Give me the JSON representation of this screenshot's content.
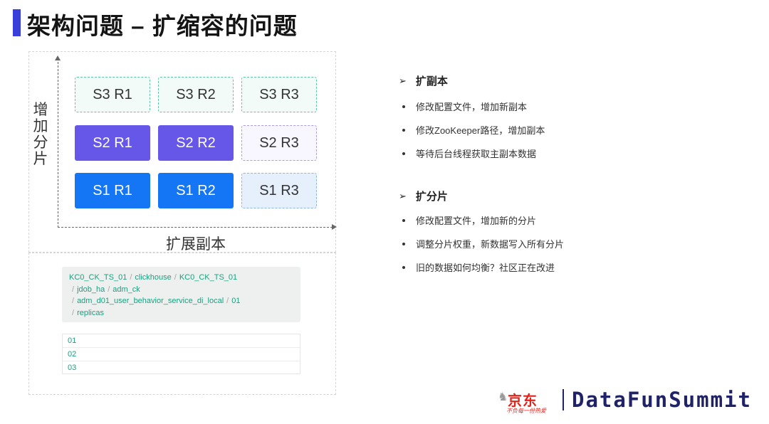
{
  "title": "架构问题 – 扩缩容的问题",
  "diagram": {
    "y_axis_label": "增加分片",
    "x_axis_label": "扩展副本",
    "rows": [
      [
        "S3 R1",
        "S3 R2",
        "S3 R3"
      ],
      [
        "S2 R1",
        "S2 R2",
        "S2 R3"
      ],
      [
        "S1 R1",
        "S1 R2",
        "S1 R3"
      ]
    ]
  },
  "zk_path": {
    "segments": [
      "KC0_CK_TS_01",
      "clickhouse",
      "KC0_CK_TS_01",
      "jdob_ha",
      "adm_ck",
      "adm_d01_user_behavior_service_di_local",
      "01",
      "replicas"
    ],
    "separator": "/"
  },
  "replica_list": [
    "01",
    "02",
    "03"
  ],
  "sections": [
    {
      "heading": "扩副本",
      "bullets": [
        "修改配置文件，增加新副本",
        "修改ZooKeeper路径，增加副本",
        "等待后台线程获取主副本数据"
      ]
    },
    {
      "heading": "扩分片",
      "bullets": [
        "修改配置文件，增加新的分片",
        "调整分片权重，新数据写入所有分片",
        "旧的数据如何均衡？社区正在改进"
      ]
    }
  ],
  "footer": {
    "jd_logo_text": "京东",
    "jd_slogan": "不负每一份热爱",
    "brand": "DataFunSummit"
  },
  "colors": {
    "accent": "#3a3fd9",
    "shard2": "#6657e8",
    "shard1": "#1576f5",
    "path_text": "#1b9f7f",
    "brand": "#1f2266",
    "jd_red": "#e2231a"
  },
  "icons": {
    "section_marker": "arrowhead-icon",
    "bullet_marker": "dot-icon"
  }
}
